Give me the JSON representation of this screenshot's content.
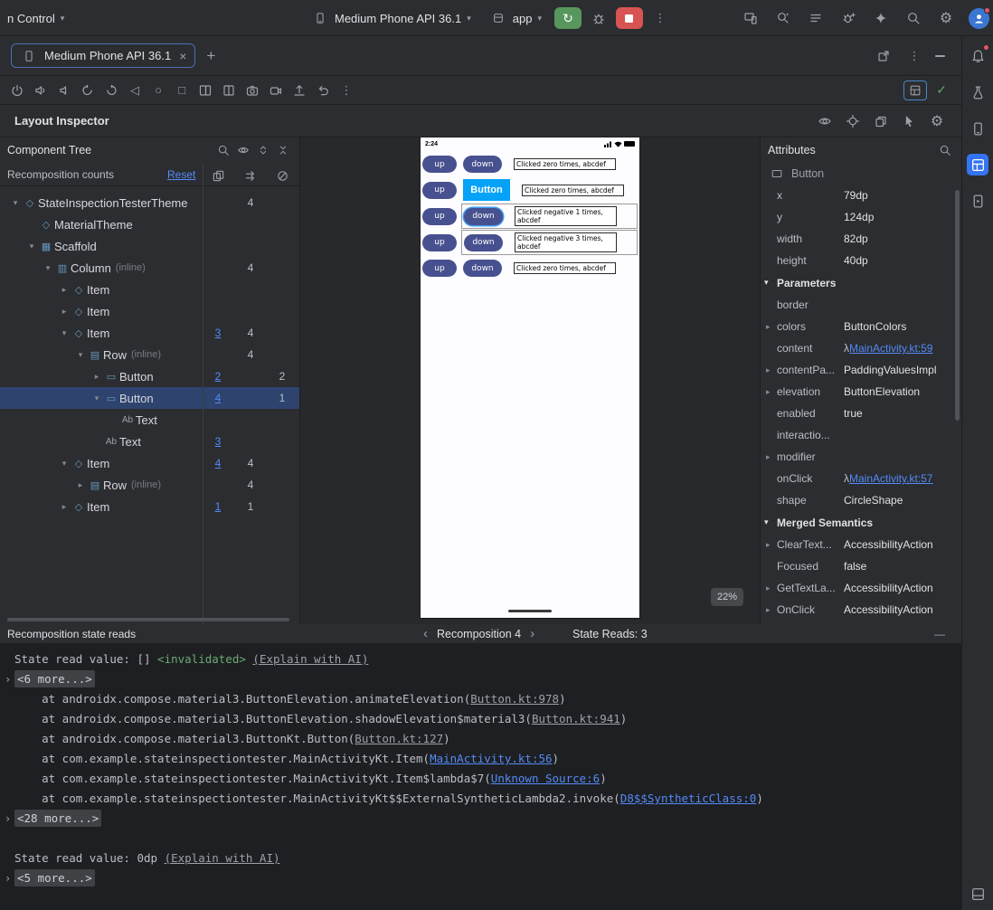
{
  "colors": {
    "accent": "#3574f0",
    "selection": "#2e436e",
    "link": "#548af7",
    "green_text": "#6aab73",
    "run_green": "#57965c",
    "stop_red": "#d75452",
    "hover_label_blue": "#05a2f8",
    "app_button_blue": "#47518f"
  },
  "titlebar": {
    "vcs": "n Control",
    "device": "Medium Phone API 36.1",
    "run_config": "app"
  },
  "tabs": {
    "active": "Medium Phone API 36.1"
  },
  "inspector_title": "Layout Inspector",
  "tree": {
    "title": "Component Tree",
    "counts_label": "Recomposition counts",
    "reset": "Reset",
    "items": [
      {
        "label": "StateInspectionTesterTheme",
        "suffix": "",
        "level": 0,
        "chevron": "down",
        "icon": "compose",
        "c1": "",
        "c2": "4",
        "c3": ""
      },
      {
        "label": "MaterialTheme",
        "suffix": "",
        "level": 1,
        "chevron": "",
        "icon": "compose",
        "c1": "",
        "c2": "",
        "c3": ""
      },
      {
        "label": "Scaffold",
        "suffix": "",
        "level": 1,
        "chevron": "down",
        "icon": "scaffold",
        "c1": "",
        "c2": "",
        "c3": ""
      },
      {
        "label": "Column",
        "suffix": "(inline)",
        "level": 2,
        "chevron": "down",
        "icon": "column",
        "c1": "",
        "c2": "4",
        "c3": ""
      },
      {
        "label": "Item",
        "suffix": "",
        "level": 3,
        "chevron": "right",
        "icon": "compose",
        "c1": "",
        "c2": "",
        "c3": ""
      },
      {
        "label": "Item",
        "suffix": "",
        "level": 3,
        "chevron": "right",
        "icon": "compose",
        "c1": "",
        "c2": "",
        "c3": ""
      },
      {
        "label": "Item",
        "suffix": "",
        "level": 3,
        "chevron": "down",
        "icon": "compose",
        "c1": "3",
        "c2": "4",
        "c3": ""
      },
      {
        "label": "Row",
        "suffix": "(inline)",
        "level": 4,
        "chevron": "down",
        "icon": "row",
        "c1": "",
        "c2": "4",
        "c3": ""
      },
      {
        "label": "Button",
        "suffix": "",
        "level": 5,
        "chevron": "right",
        "icon": "button",
        "c1": "2",
        "c2": "",
        "c3": "2"
      },
      {
        "label": "Button",
        "suffix": "",
        "level": 5,
        "chevron": "down",
        "icon": "button",
        "c1": "4",
        "c2": "",
        "c3": "1",
        "selected": true
      },
      {
        "label": "Text",
        "suffix": "",
        "level": 6,
        "chevron": "",
        "icon": "text",
        "c1": "",
        "c2": "",
        "c3": ""
      },
      {
        "label": "Text",
        "suffix": "",
        "level": 5,
        "chevron": "",
        "icon": "text",
        "c1": "3",
        "c2": "",
        "c3": ""
      },
      {
        "label": "Item",
        "suffix": "",
        "level": 3,
        "chevron": "down",
        "icon": "compose",
        "c1": "4",
        "c2": "4",
        "c3": ""
      },
      {
        "label": "Row",
        "suffix": "(inline)",
        "level": 4,
        "chevron": "right",
        "icon": "row",
        "c1": "",
        "c2": "4",
        "c3": ""
      },
      {
        "label": "Item",
        "suffix": "",
        "level": 3,
        "chevron": "right",
        "icon": "compose",
        "c1": "1",
        "c2": "1",
        "c3": ""
      }
    ]
  },
  "device": {
    "time": "2:24",
    "zoom": "22%",
    "rows": [
      {
        "up": "up",
        "down": "down",
        "down_style": "normal",
        "bordered": false,
        "text": "Clicked zero times, abcdef"
      },
      {
        "up": "up",
        "down": "Button",
        "down_style": "label",
        "bordered": false,
        "text": "Clicked zero times, abcdef"
      },
      {
        "up": "up",
        "down": "down",
        "down_style": "selected",
        "bordered": true,
        "text": "Clicked negative 1 times, abcdef"
      },
      {
        "up": "up",
        "down": "down",
        "down_style": "normal",
        "bordered": true,
        "text": "Clicked negative 3 times, abcdef"
      },
      {
        "up": "up",
        "down": "down",
        "down_style": "normal",
        "bordered": false,
        "text": "Clicked zero times, abcdef"
      }
    ]
  },
  "attributes": {
    "title": "Attributes",
    "component": "Button",
    "rows": [
      {
        "kind": "prop",
        "name": "x",
        "value": "79dp"
      },
      {
        "kind": "prop",
        "name": "y",
        "value": "124dp"
      },
      {
        "kind": "prop",
        "name": "width",
        "value": "82dp"
      },
      {
        "kind": "prop",
        "name": "height",
        "value": "40dp"
      },
      {
        "kind": "section",
        "title": "Parameters"
      },
      {
        "kind": "prop",
        "name": "border",
        "value": ""
      },
      {
        "kind": "prop",
        "name": "colors",
        "value": "ButtonColors",
        "expand": true
      },
      {
        "kind": "prop",
        "name": "content",
        "value": "MainActivity.kt:59",
        "lambda": true
      },
      {
        "kind": "prop",
        "name": "contentPa...",
        "value": "PaddingValuesImpl",
        "expand": true
      },
      {
        "kind": "prop",
        "name": "elevation",
        "value": "ButtonElevation",
        "expand": true
      },
      {
        "kind": "prop",
        "name": "enabled",
        "value": "true"
      },
      {
        "kind": "prop",
        "name": "interactio...",
        "value": ""
      },
      {
        "kind": "prop",
        "name": "modifier",
        "value": "",
        "expand": true
      },
      {
        "kind": "prop",
        "name": "onClick",
        "value": "MainActivity.kt:57",
        "lambda": true
      },
      {
        "kind": "prop",
        "name": "shape",
        "value": "CircleShape"
      },
      {
        "kind": "section",
        "title": "Merged Semantics"
      },
      {
        "kind": "prop",
        "name": "ClearText...",
        "value": "AccessibilityAction",
        "expand": true
      },
      {
        "kind": "prop",
        "name": "Focused",
        "value": "false"
      },
      {
        "kind": "prop",
        "name": "GetTextLa...",
        "value": "AccessibilityAction",
        "expand": true
      },
      {
        "kind": "prop",
        "name": "OnClick",
        "value": "AccessibilityAction",
        "expand": true
      }
    ]
  },
  "bottom": {
    "title": "Recomposition state reads",
    "nav_label": "Recomposition 4",
    "state_reads": "State Reads: 3"
  },
  "console": {
    "lines": [
      {
        "fold": false,
        "parts": [
          [
            "State read value: [] ",
            "p"
          ],
          [
            "<invalidated>",
            "g"
          ],
          [
            " ",
            "p"
          ],
          [
            "(Explain with AI)",
            "ld"
          ]
        ]
      },
      {
        "fold": true,
        "parts": [
          [
            "<6 more...>",
            "f"
          ]
        ]
      },
      {
        "fold": false,
        "parts": [
          [
            "    at androidx.compose.material3.ButtonElevation.animateElevation(",
            "p"
          ],
          [
            "Button.kt:978",
            "ld"
          ],
          [
            ")",
            "p"
          ]
        ]
      },
      {
        "fold": false,
        "parts": [
          [
            "    at androidx.compose.material3.ButtonElevation.shadowElevation$material3(",
            "p"
          ],
          [
            "Button.kt:941",
            "ld"
          ],
          [
            ")",
            "p"
          ]
        ]
      },
      {
        "fold": false,
        "parts": [
          [
            "    at androidx.compose.material3.ButtonKt.Button(",
            "p"
          ],
          [
            "Button.kt:127",
            "ld"
          ],
          [
            ")",
            "p"
          ]
        ]
      },
      {
        "fold": false,
        "parts": [
          [
            "    at com.example.stateinspectiontester.MainActivityKt.Item(",
            "p"
          ],
          [
            "MainActivity.kt:56",
            "lb"
          ],
          [
            ")",
            "p"
          ]
        ]
      },
      {
        "fold": false,
        "parts": [
          [
            "    at com.example.stateinspectiontester.MainActivityKt.Item$lambda$7(",
            "p"
          ],
          [
            "Unknown Source:6",
            "lb"
          ],
          [
            ")",
            "p"
          ]
        ]
      },
      {
        "fold": false,
        "parts": [
          [
            "    at com.example.stateinspectiontester.MainActivityKt$$ExternalSyntheticLambda2.invoke(",
            "p"
          ],
          [
            "D8$$SyntheticClass:0",
            "lb"
          ],
          [
            ")",
            "p"
          ]
        ]
      },
      {
        "fold": true,
        "parts": [
          [
            "<28 more...>",
            "f"
          ]
        ]
      },
      {
        "fold": false,
        "parts": [
          [
            "",
            ""
          ]
        ]
      },
      {
        "fold": false,
        "parts": [
          [
            "State read value: 0dp ",
            "p"
          ],
          [
            "(Explain with AI)",
            "ld"
          ]
        ]
      },
      {
        "fold": true,
        "parts": [
          [
            "<5 more...>",
            "f"
          ]
        ]
      }
    ]
  },
  "icons": {
    "chevron_expanded": "▾",
    "chevron_collapsed": "▸",
    "compose": "◇",
    "scaffold": "▦",
    "column": "▥",
    "row": "▤",
    "button": "▭",
    "text": "Ab",
    "fold_chevron": "›"
  }
}
